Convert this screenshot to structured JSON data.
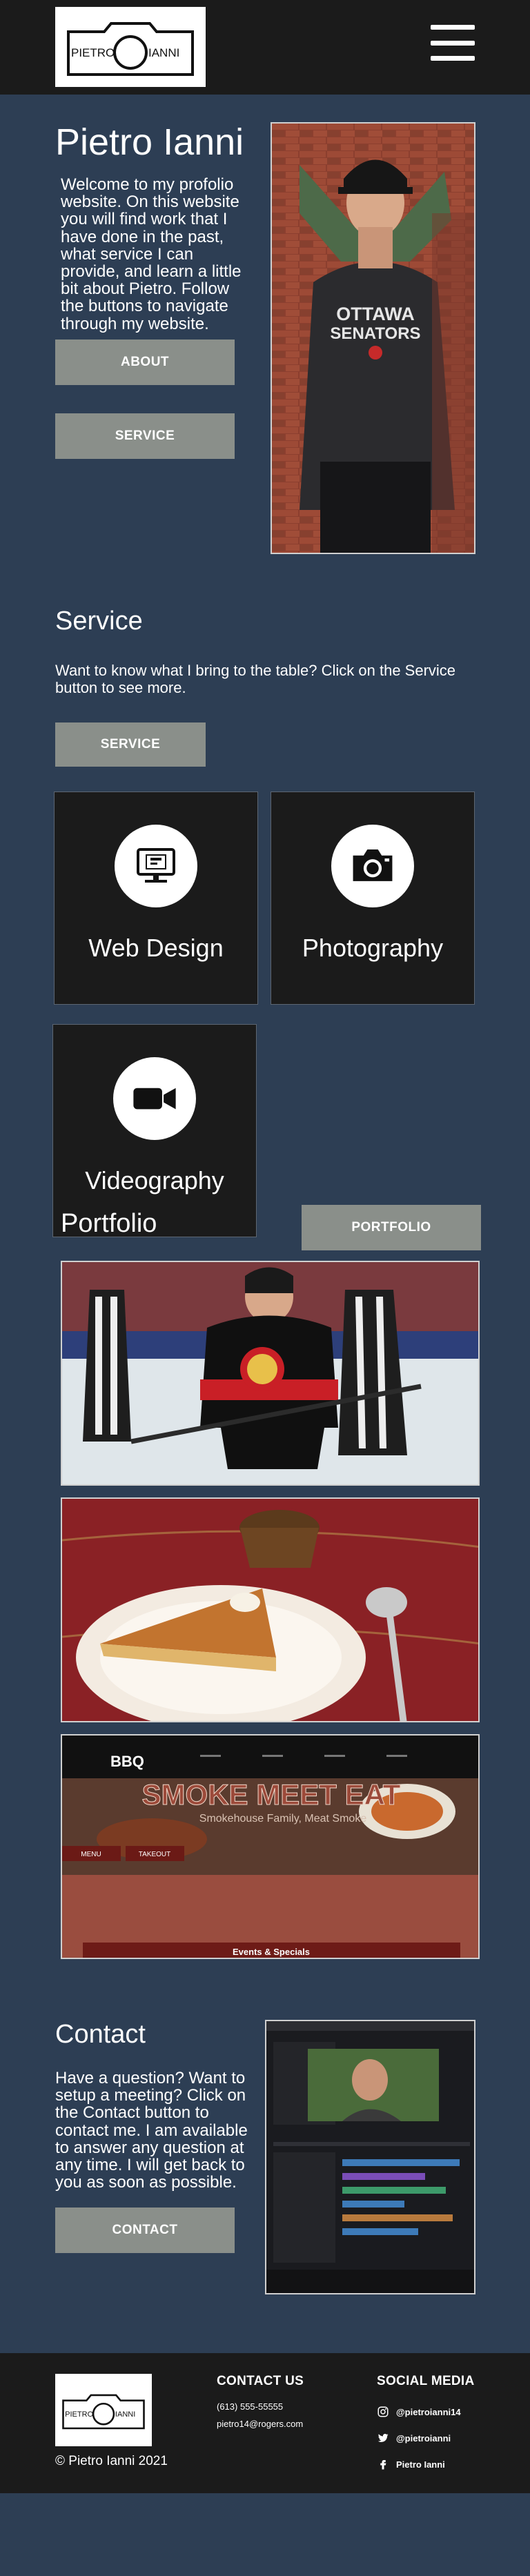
{
  "header": {
    "logo_left": "PIETRO",
    "logo_right": "IANNI",
    "menu_icon": "hamburger-menu-icon"
  },
  "hero": {
    "title": "Pietro Ianni",
    "text": "Welcome to my profolio website. On this website you will find work that I have done in the past, what service I can provide, and learn a little bit about Pietro. Follow the buttons to navigate through my website.",
    "about_label": "ABOUT",
    "service_label": "SERVICE",
    "photo_shirt_line1": "OTTAWA",
    "photo_shirt_line2": "SENATORS"
  },
  "service": {
    "title": "Service",
    "text": "Want to know what I bring to the table? Click on the Service button to see more.",
    "button_label": "SERVICE",
    "cards": [
      {
        "label": "Web Design",
        "icon": "computer-monitor-icon"
      },
      {
        "label": "Photography",
        "icon": "camera-icon"
      },
      {
        "label": "Videography",
        "icon": "video-camera-icon"
      }
    ]
  },
  "portfolio": {
    "title": "Portfolio",
    "button_label": "PORTFOLIO",
    "bbq": {
      "brand": "BBQ",
      "headline": "SMOKE MEET EAT",
      "sub": "Smokehouse Family, Meat Smoke",
      "menu": "MENU",
      "takeout": "TAKEOUT",
      "events": "Events & Specials"
    }
  },
  "contact": {
    "title": "Contact",
    "text": "Have a question? Want to setup a meeting? Click on the Contact button to contact me. I am available to answer any question at any time. I will get back to you as soon as possible.",
    "button_label": "CONTACT"
  },
  "footer": {
    "logo_left": "PIETRO",
    "logo_right": "IANNI",
    "copyright": "© Pietro Ianni 2021",
    "contact_heading": "CONTACT US",
    "phone": "(613) 555-55555",
    "email": "pietro14@rogers.com",
    "social_heading": "SOCIAL MEDIA",
    "social": [
      {
        "label": "@pietroianni14",
        "icon": "instagram-icon"
      },
      {
        "label": "@pietroianni",
        "icon": "twitter-icon"
      },
      {
        "label": "Pietro Ianni",
        "icon": "facebook-icon"
      }
    ]
  },
  "colors": {
    "background": "#2d3e54",
    "header_footer": "#1b1b1b",
    "button": "#8a8f8a",
    "card": "#1b1b1b"
  }
}
